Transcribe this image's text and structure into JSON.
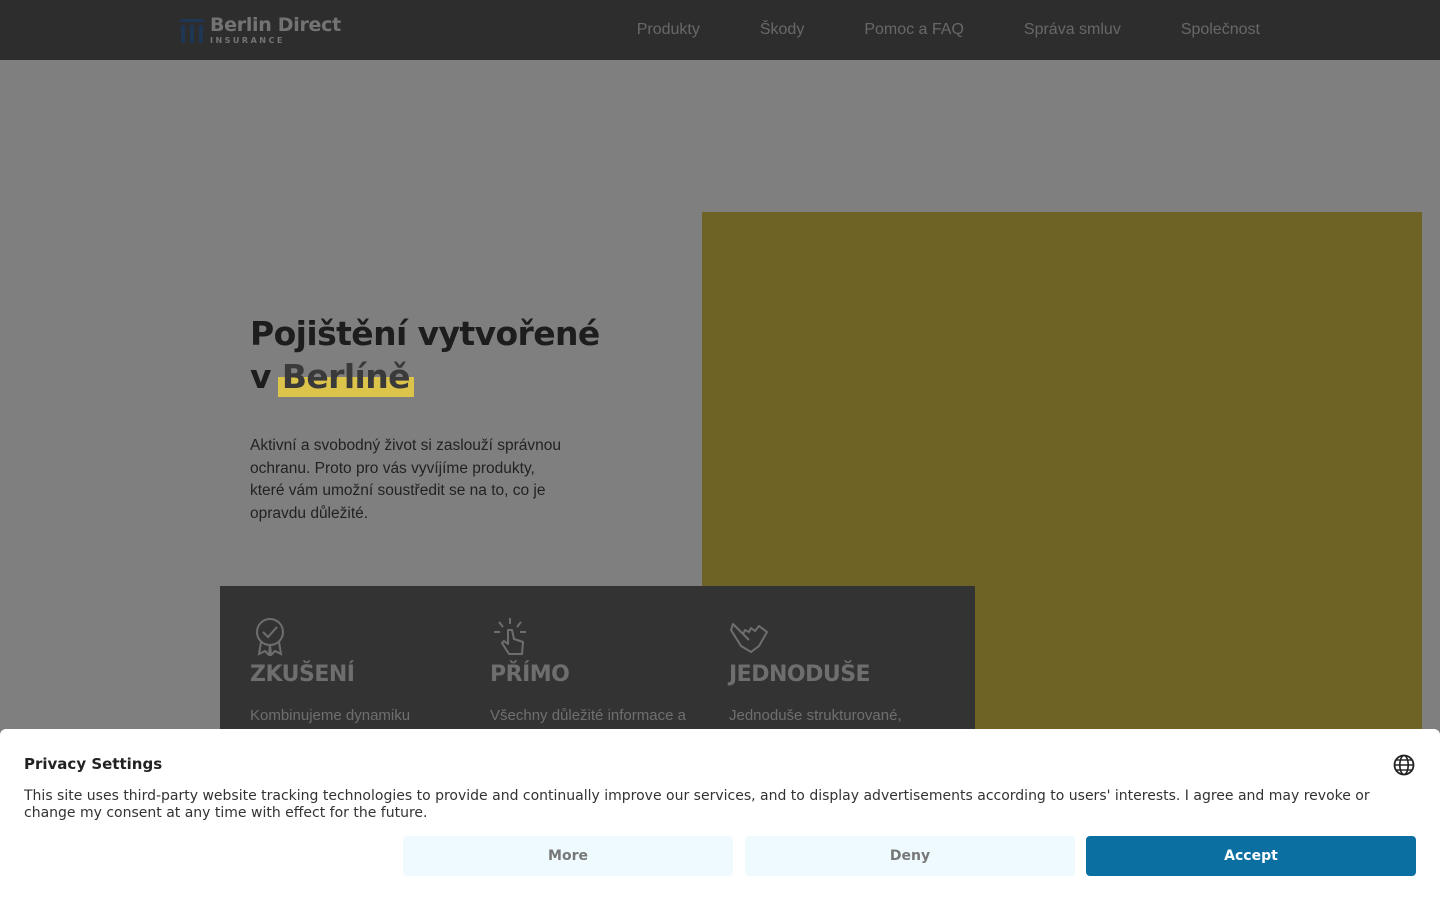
{
  "header": {
    "logo_name": "Berlin Direct",
    "logo_sub": "INSURANCE",
    "nav": [
      "Produkty",
      "Škody",
      "Pomoc a FAQ",
      "Správa smluv",
      "Společnost"
    ]
  },
  "hero": {
    "title_line1": "Pojištění vytvořené",
    "title_line2_prefix": "v ",
    "title_line2_highlight": "Berlíně",
    "text": "Aktivní a svobodný život si zaslouží správnou ochranu. Proto pro vás vyvíjíme produkty, které vám umožní soustředit se na to, co je opravdu důležité."
  },
  "features": [
    {
      "icon": "badge-check-icon",
      "title": "ZKUŠENÍ",
      "text": "Kombinujeme dynamiku"
    },
    {
      "icon": "tap-hand-icon",
      "title": "PŘÍMO",
      "text": "Všechny důležité informace a"
    },
    {
      "icon": "shaka-hand-icon",
      "title": "JEDNODUŠE",
      "text": "Jednoduše strukturované,"
    }
  ],
  "consent": {
    "title": "Privacy Settings",
    "text": "This site uses third-party website tracking technologies to provide and continually improve our services, and to display advertisements according to users' interests. I agree and may revoke or change my consent at any time with effect for the future.",
    "more_label": "More",
    "deny_label": "Deny",
    "accept_label": "Accept"
  },
  "colors": {
    "brand_yellow": "#dcc44a",
    "accept_blue": "#0c6fa2",
    "logo_blue": "#3f6fa8"
  }
}
